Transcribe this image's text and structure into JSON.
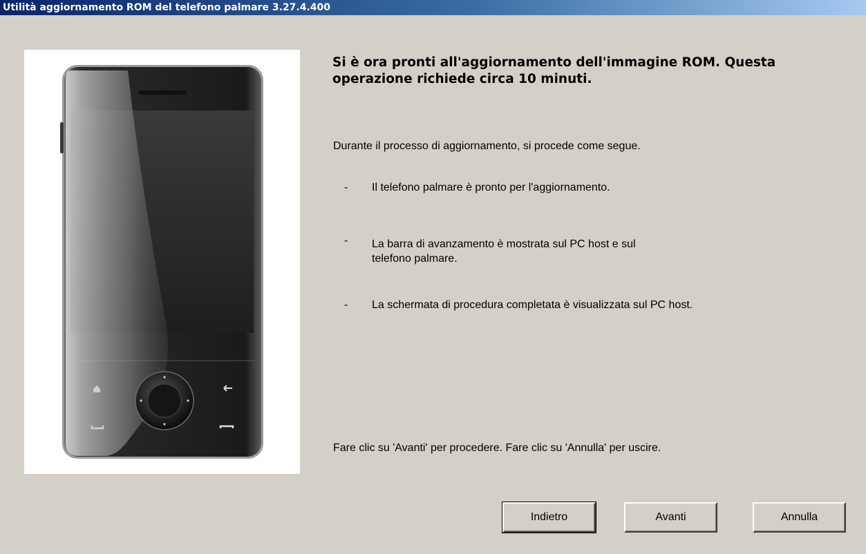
{
  "window": {
    "title": "Utilità aggiornamento ROM del telefono palmare 3.27.4.400"
  },
  "content": {
    "headline": "Si è ora pronti all'aggiornamento dell'immagine ROM. Questa operazione richiede circa 10 minuti.",
    "intro": "Durante il processo di aggiornamento, si procede come segue.",
    "steps": [
      {
        "dash": "-",
        "text": "Il telefono palmare è pronto per l'aggiornamento."
      },
      {
        "dash": "-",
        "text": "La barra di avanzamento è mostrata sul PC host e sul telefono palmare."
      },
      {
        "dash": "-",
        "text": "La schermata di  procedura completata è visualizzata sul PC host."
      }
    ],
    "instruction": "Fare clic su 'Avanti' per procedere. Fare clic su 'Annulla' per uscire."
  },
  "buttons": {
    "back_label": "Indietro",
    "next_label": "Avanti",
    "cancel_label": "Annulla"
  },
  "colors": {
    "dialog_background": "#d4d0c8",
    "titlebar_start": "#0a246a",
    "titlebar_end": "#a6caf0"
  },
  "icons": {
    "device_illustration": "smartphone-illustration"
  }
}
